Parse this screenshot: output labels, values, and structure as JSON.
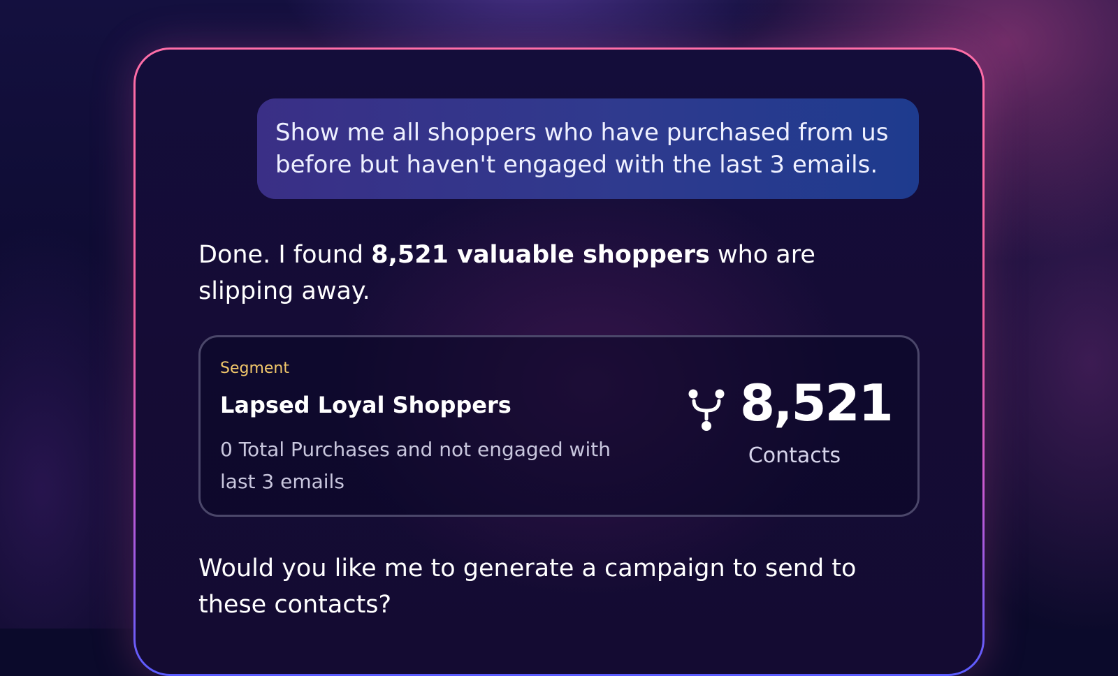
{
  "chat": {
    "user_message": "Show me all shoppers who have purchased from us before but haven't engaged with the last 3 emails.",
    "assistant_intro": {
      "prefix": "Done. I found ",
      "highlight": "8,521 valuable shoppers",
      "suffix": " who are slipping away."
    },
    "segment": {
      "label": "Segment",
      "title": "Lapsed Loyal Shoppers",
      "description": "0 Total Purchases and not engaged with last 3 emails",
      "icon": "branch-merge-icon",
      "count": "8,521",
      "count_label": "Contacts"
    },
    "assistant_question": "Would you like me to generate a campaign to send to these contacts?"
  },
  "colors": {
    "segment_label": "#f2c86b",
    "card_border": "#ff6ea8",
    "user_bubble": "#2f3a8e"
  }
}
